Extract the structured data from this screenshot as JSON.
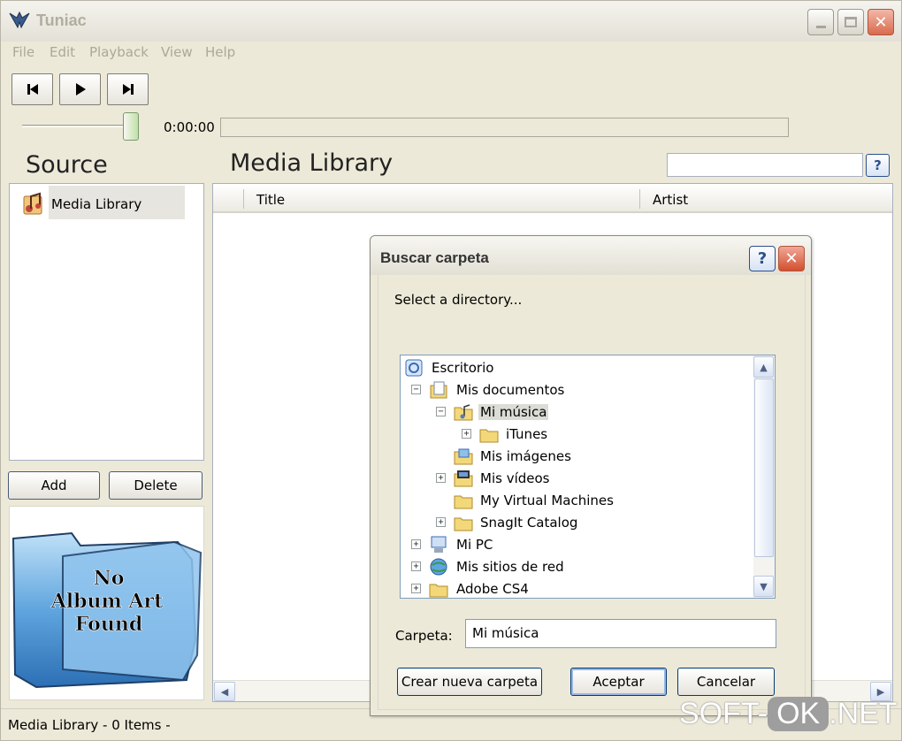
{
  "window": {
    "title": "Tuniac"
  },
  "menu": [
    "File",
    "Edit",
    "Playback",
    "View",
    "Help"
  ],
  "transport": {
    "prev_icon": "previous-track-icon",
    "play_icon": "play-icon",
    "next_icon": "next-track-icon",
    "time": "0:00:00",
    "volume_level": 1.0
  },
  "source": {
    "title": "Source",
    "items": [
      {
        "label": "Media Library",
        "icon": "media-library-icon"
      }
    ],
    "add_label": "Add",
    "delete_label": "Delete",
    "album_art": {
      "line1": "No",
      "line2": "Album Art",
      "line3": "Found"
    }
  },
  "library": {
    "title": "Media Library",
    "search_value": "",
    "help_label": "?",
    "columns": [
      "Title",
      "Artist"
    ]
  },
  "status": {
    "text": "Media Library - 0 Items -"
  },
  "dialog": {
    "title": "Buscar carpeta",
    "help_label": "?",
    "prompt": "Select a directory...",
    "tree": [
      {
        "label": "Escritorio",
        "level": 0,
        "expander": "",
        "icon": "desktop-icon"
      },
      {
        "label": "Mis documentos",
        "level": 1,
        "expander": "−",
        "icon": "my-documents-icon"
      },
      {
        "label": "Mi música",
        "level": 2,
        "expander": "−",
        "icon": "music-folder-icon",
        "selected": true
      },
      {
        "label": "iTunes",
        "level": 3,
        "expander": "+",
        "icon": "folder-icon"
      },
      {
        "label": "Mis imágenes",
        "level": 2,
        "expander": "",
        "icon": "pictures-folder-icon"
      },
      {
        "label": "Mis vídeos",
        "level": 2,
        "expander": "+",
        "icon": "videos-folder-icon"
      },
      {
        "label": "My Virtual Machines",
        "level": 2,
        "expander": "",
        "icon": "folder-icon"
      },
      {
        "label": "SnagIt Catalog",
        "level": 2,
        "expander": "+",
        "icon": "folder-icon"
      },
      {
        "label": "Mi PC",
        "level": 1,
        "expander": "+",
        "icon": "my-computer-icon"
      },
      {
        "label": "Mis sitios de red",
        "level": 1,
        "expander": "+",
        "icon": "network-places-icon"
      },
      {
        "label": "Adobe CS4",
        "level": 1,
        "expander": "+",
        "icon": "folder-icon"
      }
    ],
    "folder_label": "Carpeta:",
    "folder_value": "Mi música",
    "new_folder_label": "Crear nueva carpeta",
    "ok_label": "Aceptar",
    "cancel_label": "Cancelar"
  },
  "watermark": {
    "left": "SOFT-",
    "ok": "OK",
    "right": ".NET"
  }
}
